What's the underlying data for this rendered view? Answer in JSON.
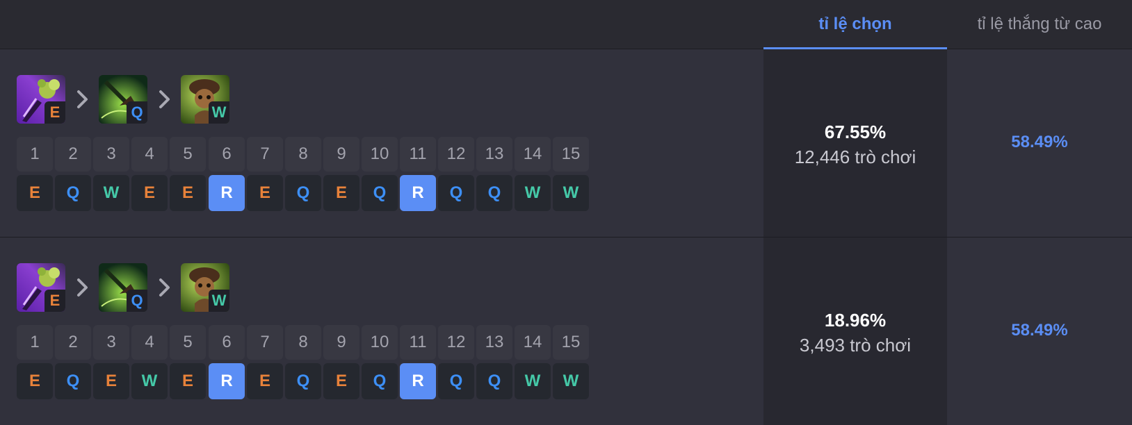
{
  "header": {
    "tab_pick_rate": "tỉ lệ chọn",
    "tab_win_rate": "tỉ lệ thắng từ cao"
  },
  "colors": {
    "accent": "#5b8ef5",
    "key_E": "#e8823a",
    "key_Q": "#3d8ff5",
    "key_W": "#45c9a8"
  },
  "rows": [
    {
      "priority": [
        {
          "key": "E",
          "icon": "purple-poison-flask-icon"
        },
        {
          "key": "Q",
          "icon": "green-blinding-dart-icon"
        },
        {
          "key": "W",
          "icon": "brown-mushroom-scout-icon"
        }
      ],
      "levels": [
        "1",
        "2",
        "3",
        "4",
        "5",
        "6",
        "7",
        "8",
        "9",
        "10",
        "11",
        "12",
        "13",
        "14",
        "15"
      ],
      "skills": [
        "E",
        "Q",
        "W",
        "E",
        "E",
        "R",
        "E",
        "Q",
        "E",
        "Q",
        "R",
        "Q",
        "Q",
        "W",
        "W"
      ],
      "pick_rate": "67.55%",
      "games": "12,446 trò chơi",
      "win_rate": "58.49%"
    },
    {
      "priority": [
        {
          "key": "E",
          "icon": "purple-poison-flask-icon"
        },
        {
          "key": "Q",
          "icon": "green-blinding-dart-icon"
        },
        {
          "key": "W",
          "icon": "brown-mushroom-scout-icon"
        }
      ],
      "levels": [
        "1",
        "2",
        "3",
        "4",
        "5",
        "6",
        "7",
        "8",
        "9",
        "10",
        "11",
        "12",
        "13",
        "14",
        "15"
      ],
      "skills": [
        "E",
        "Q",
        "E",
        "W",
        "E",
        "R",
        "E",
        "Q",
        "E",
        "Q",
        "R",
        "Q",
        "Q",
        "W",
        "W"
      ],
      "pick_rate": "18.96%",
      "games": "3,493 trò chơi",
      "win_rate": "58.49%"
    }
  ]
}
